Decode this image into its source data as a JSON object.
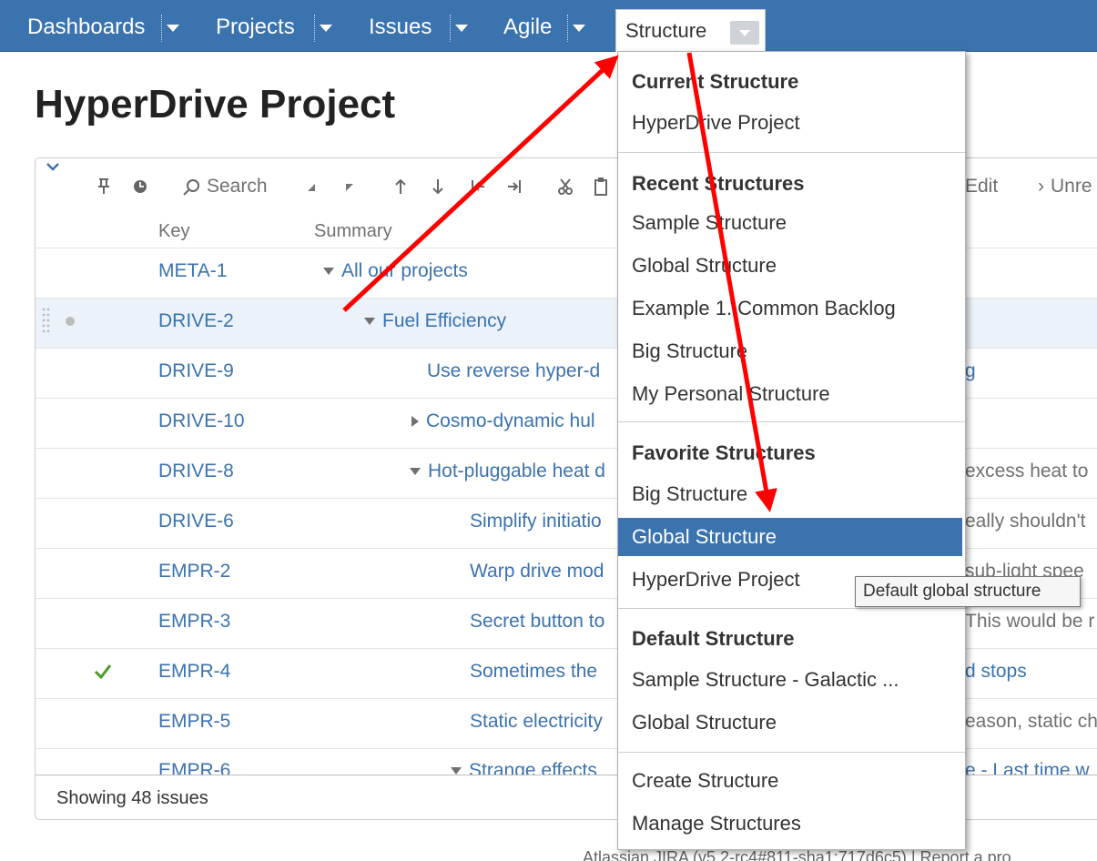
{
  "nav": {
    "items": [
      {
        "label": "Dashboards"
      },
      {
        "label": "Projects"
      },
      {
        "label": "Issues"
      },
      {
        "label": "Agile"
      }
    ],
    "structure_label": "Structure"
  },
  "page": {
    "title": "HyperDrive Project"
  },
  "toolbar": {
    "search_label": "Search",
    "edit_label": "Edit",
    "unre_label": "Unre"
  },
  "columns": {
    "key": "Key",
    "summary": "Summary"
  },
  "rows": [
    {
      "key": "META-1",
      "summary": "All our projects",
      "right": ""
    },
    {
      "key": "DRIVE-2",
      "summary": "Fuel Efficiency",
      "right": ""
    },
    {
      "key": "DRIVE-9",
      "summary": "Use reverse hyper-d",
      "right": "g"
    },
    {
      "key": "DRIVE-10",
      "summary": "Cosmo-dynamic hul",
      "right": ""
    },
    {
      "key": "DRIVE-8",
      "summary": "Hot-pluggable heat d",
      "right": "excess heat to"
    },
    {
      "key": "DRIVE-6",
      "summary": "Simplify initiatio",
      "right": "eally shouldn't"
    },
    {
      "key": "EMPR-2",
      "summary": "Warp drive mod",
      "right": "sub-light spee"
    },
    {
      "key": "EMPR-3",
      "summary": "Secret button to",
      "right": "This would be r"
    },
    {
      "key": "EMPR-4",
      "summary": "Sometimes the",
      "right": "d stops"
    },
    {
      "key": "EMPR-5",
      "summary": "Static electricity",
      "right": "eason, static ch"
    },
    {
      "key": "EMPR-6",
      "summary": "Strange effects",
      "right": "e - Last time w"
    }
  ],
  "footer": {
    "showing": "Showing 48 issues",
    "atlassian": "Atlassian JIRA (v5.2-rc4#811-sha1:717d6c5)  |  Report a pro"
  },
  "menu": {
    "current_heading": "Current Structure",
    "current_items": [
      "HyperDrive Project"
    ],
    "recent_heading": "Recent Structures",
    "recent_items": [
      "Sample Structure",
      "Global Structure",
      "Example 1. Common Backlog",
      "Big Structure",
      "My Personal Structure"
    ],
    "favorite_heading": "Favorite Structures",
    "favorite_items": [
      "Big Structure",
      "Global Structure",
      "HyperDrive Project"
    ],
    "default_heading": "Default Structure",
    "default_items": [
      "Sample Structure - Galactic ...",
      "Global Structure"
    ],
    "actions": [
      "Create Structure",
      "Manage Structures"
    ]
  },
  "tooltip": "Default global structure",
  "colors": {
    "nav_bg": "#3b73af",
    "link": "#3b73af",
    "arrow": "#ff0000",
    "check": "#4a9a2a"
  }
}
